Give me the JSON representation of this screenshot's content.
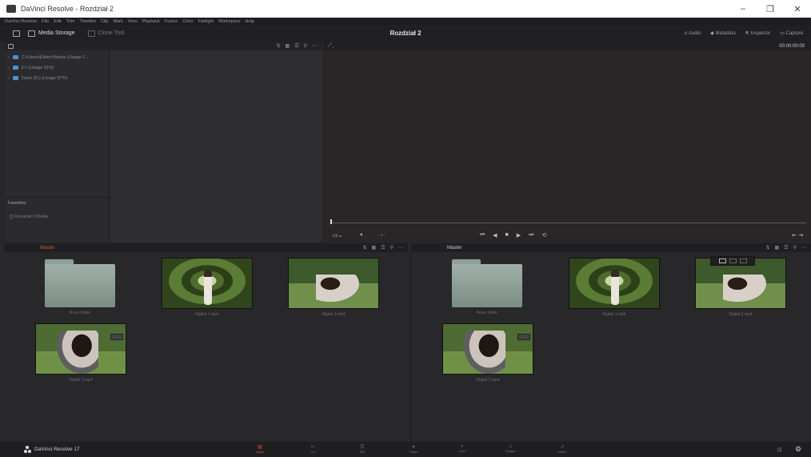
{
  "window": {
    "title": "DaVinci Resolve - Rozdział 2",
    "controls": [
      "–",
      "❐",
      "✕"
    ]
  },
  "menu": [
    "DaVinci Resolve",
    "File",
    "Edit",
    "Trim",
    "Timeline",
    "Clip",
    "Mark",
    "View",
    "Playback",
    "Fusion",
    "Color",
    "Fairlight",
    "Workspace",
    "Help"
  ],
  "toolbar": {
    "media_storage": "Media Storage",
    "clone_tool": "Clone Tool",
    "project_title": "Rozdział 2",
    "right": {
      "audio": "Audio",
      "metadata": "Metadata",
      "inspector": "Inspector",
      "capture": "Capture"
    }
  },
  "media_storage": {
    "volumes": [
      "C:\\Users\\Editor\\Videos (Usage 1...",
      "D:\\ (Usage 91%)",
      "Dane (D:) (Usage 57%)"
    ],
    "favorites_title": "Favorites",
    "favorite_item": "Rozdział 2 Media"
  },
  "viewer": {
    "timecode": "00:00:00:00",
    "controls": [
      "⏮",
      "◀",
      "■",
      "▶",
      "⏭",
      "⟲"
    ]
  },
  "left_bin": {
    "title": "Master",
    "title_color": "#e0533d",
    "clips": [
      {
        "name": "Nowy folder",
        "kind": "folder"
      },
      {
        "name": "Digital 1.mp4",
        "kind": "video"
      },
      {
        "name": "Digital 2.mp4",
        "kind": "video"
      },
      {
        "name": "Digital 3.mp4",
        "kind": "video"
      }
    ]
  },
  "right_bin": {
    "title": "Master",
    "title_color": "#cfcfcf",
    "clips": [
      {
        "name": "Nowy folder",
        "kind": "folder"
      },
      {
        "name": "Digital 1.mp4",
        "kind": "video"
      },
      {
        "name": "Digital 2.mp4",
        "kind": "video"
      },
      {
        "name": "Digital 3.mp4",
        "kind": "video"
      }
    ]
  },
  "pages": [
    {
      "label": "Media",
      "icon": "▤",
      "active": true
    },
    {
      "label": "Cut",
      "icon": "✂",
      "active": false
    },
    {
      "label": "Edit",
      "icon": "☰",
      "active": false
    },
    {
      "label": "Fusion",
      "icon": "✦",
      "active": false
    },
    {
      "label": "Color",
      "icon": "◐",
      "active": false
    },
    {
      "label": "Fairlight",
      "icon": "♫",
      "active": false
    },
    {
      "label": "Deliver",
      "icon": "➚",
      "active": false
    }
  ],
  "footer": {
    "brand": "DaVinci Resolve 17",
    "home_icon": "⌂",
    "settings_icon": "⚙"
  },
  "colors": {
    "accent": "#e0533d",
    "disk": "#4b8fd6"
  }
}
